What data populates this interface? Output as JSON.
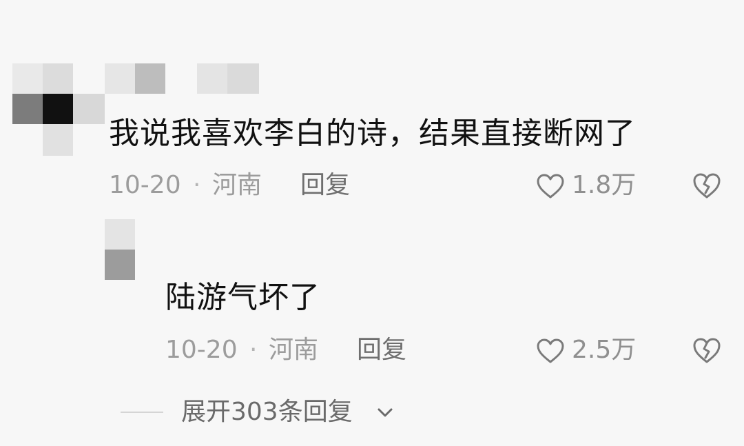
{
  "comment": {
    "text": "我说我喜欢李白的诗，结果直接断网了",
    "date": "10-20",
    "separator": "·",
    "location": "河南",
    "reply_label": "回复",
    "likes": "1.8万",
    "like_icon": "heart-outline-icon",
    "dislike_icon": "broken-heart-icon"
  },
  "reply": {
    "text": "陆游气坏了",
    "date": "10-20",
    "separator": "·",
    "location": "河南",
    "reply_label": "回复",
    "likes": "2.5万",
    "like_icon": "heart-outline-icon",
    "dislike_icon": "broken-heart-icon"
  },
  "expand": {
    "label": "展开303条回复",
    "icon": "chevron-down-icon"
  },
  "colors": {
    "background": "#f7f7f7",
    "text_primary": "#111111",
    "text_secondary": "#9c9c9c",
    "icon_gray": "#7a7a7a"
  }
}
